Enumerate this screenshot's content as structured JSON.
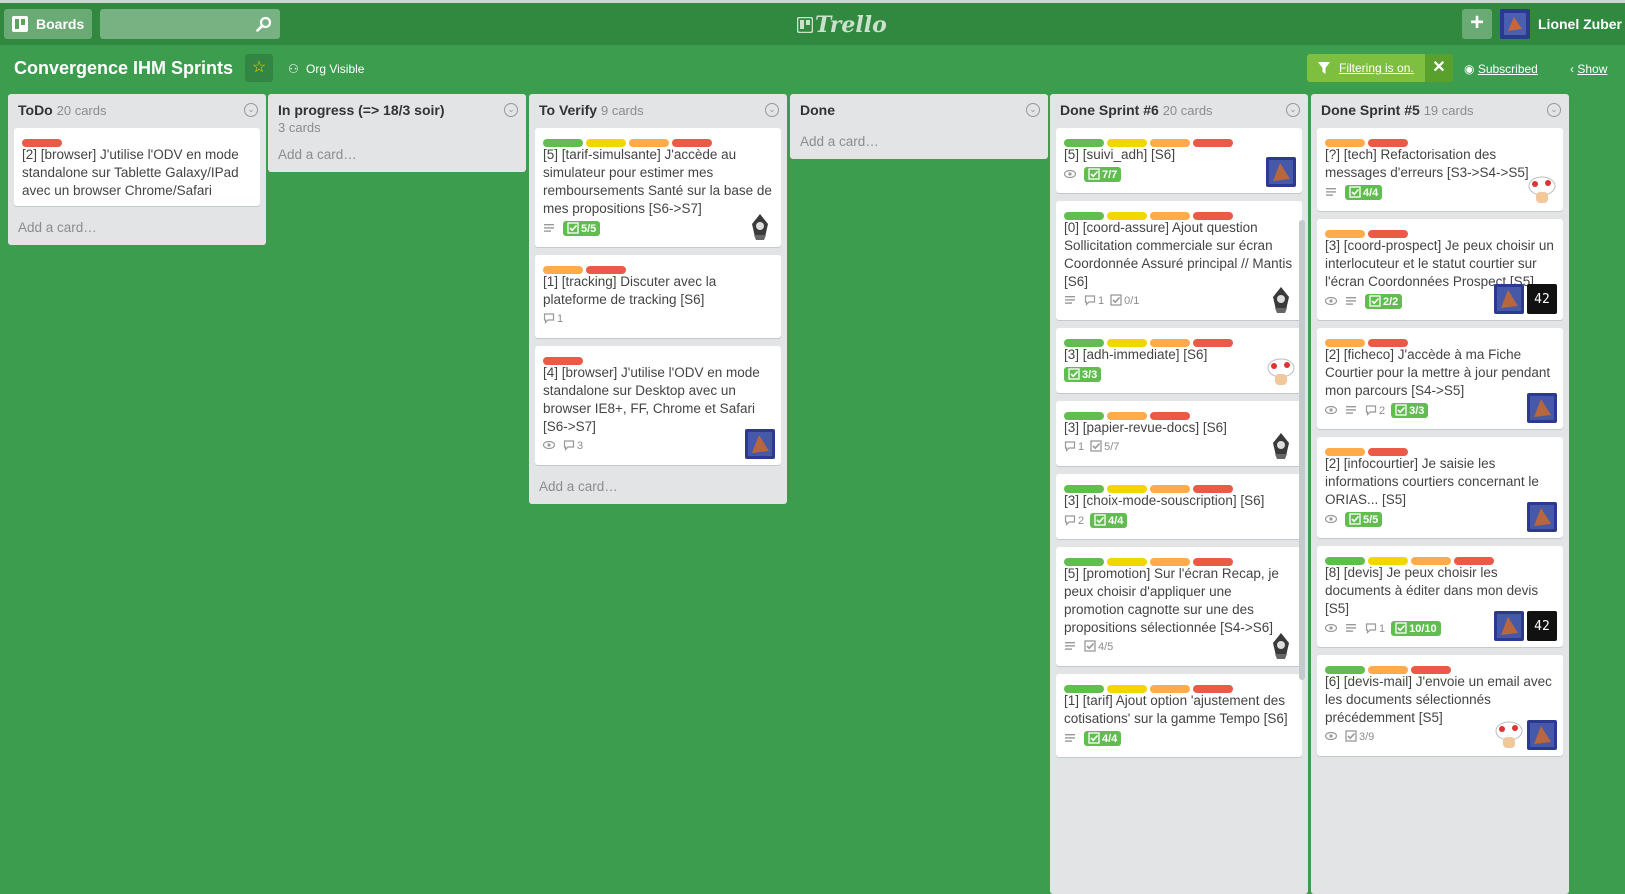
{
  "header": {
    "boards_label": "Boards",
    "search_placeholder": "",
    "logo": "Trello",
    "user_name": "Lionel Zuber"
  },
  "board": {
    "title": "Convergence IHM Sprints",
    "visibility": "Org Visible",
    "filter_label": "Filtering is on.",
    "subscribed_label": "Subscribed",
    "show_label": "Show"
  },
  "colors": {
    "green": "#61bd4f",
    "yellow": "#f2d600",
    "orange": "#ffab4a",
    "red": "#eb5a46"
  },
  "lists": [
    {
      "name": "ToDo",
      "count": "20 cards",
      "add_card": "Add a card…",
      "cards": [
        {
          "labels": [
            "red"
          ],
          "title": "[2] [browser] J'utilise l'ODV en mode standalone sur Tablette Galaxy/IPad avec un browser Chrome/Safari",
          "badges": [],
          "members": []
        }
      ]
    },
    {
      "name": "In progress (=> 18/3 soir)",
      "count": "3 cards",
      "add_card": "Add a card…",
      "cards": []
    },
    {
      "name": "To Verify",
      "count": "9 cards",
      "add_card": "Add a card…",
      "cards": [
        {
          "labels": [
            "green",
            "yellow",
            "orange",
            "red"
          ],
          "title": "[5] [tarif-simulsante] J'accède au simulateur pour estimer mes remboursements Santé sur la base de mes propositions [S6->S7]",
          "badges": [
            {
              "type": "desc"
            },
            {
              "type": "checklist",
              "text": "5/5",
              "done": true
            }
          ],
          "members": [
            "assassin"
          ]
        },
        {
          "labels": [
            "orange",
            "red"
          ],
          "title": "[1] [tracking] Discuter avec la plateforme de tracking [S6]",
          "badges": [
            {
              "type": "comments",
              "text": "1"
            }
          ],
          "members": []
        },
        {
          "labels": [
            "red"
          ],
          "title": "[4] [browser] J'utilise l'ODV en mode standalone sur Desktop avec un browser IE8+, FF, Chrome et Safari [S6->S7]",
          "badges": [
            {
              "type": "watch"
            },
            {
              "type": "comments",
              "text": "3"
            }
          ],
          "members": [
            "blue"
          ]
        }
      ]
    },
    {
      "name": "Done",
      "count": "",
      "add_card": "Add a card…",
      "cards": []
    },
    {
      "name": "Done Sprint #6",
      "count": "20 cards",
      "add_card": "",
      "cards": [
        {
          "labels": [
            "green",
            "yellow",
            "orange",
            "red"
          ],
          "title": "[5] [suivi_adh] [S6]",
          "badges": [
            {
              "type": "watch"
            },
            {
              "type": "checklist",
              "text": "7/7",
              "done": true
            }
          ],
          "members": [
            "blue"
          ]
        },
        {
          "labels": [
            "green",
            "yellow",
            "orange",
            "red"
          ],
          "title": "[0] [coord-assure] Ajout question Sollicitation commerciale sur écran Coordonnée Assuré principal // Mantis [S6]",
          "badges": [
            {
              "type": "desc"
            },
            {
              "type": "comments",
              "text": "1"
            },
            {
              "type": "checklist",
              "text": "0/1",
              "done": false
            }
          ],
          "members": [
            "assassin"
          ]
        },
        {
          "labels": [
            "green",
            "yellow",
            "orange",
            "red"
          ],
          "title": "[3] [adh-immediate] [S6]",
          "badges": [
            {
              "type": "checklist",
              "text": "3/3",
              "done": true
            }
          ],
          "members": [
            "toad"
          ]
        },
        {
          "labels": [
            "green",
            "orange",
            "red"
          ],
          "title": "[3] [papier-revue-docs] [S6]",
          "badges": [
            {
              "type": "comments",
              "text": "1"
            },
            {
              "type": "checklist",
              "text": "5/7",
              "done": false
            }
          ],
          "members": [
            "assassin"
          ]
        },
        {
          "labels": [
            "green",
            "yellow",
            "orange",
            "red"
          ],
          "title": "[3] [choix-mode-souscription] [S6]",
          "badges": [
            {
              "type": "comments",
              "text": "2"
            },
            {
              "type": "checklist",
              "text": "4/4",
              "done": true
            }
          ],
          "members": []
        },
        {
          "labels": [
            "green",
            "yellow",
            "orange",
            "red"
          ],
          "title": "[5] [promotion] Sur l'écran Recap, je peux choisir d'appliquer une promotion cagnotte sur une des propositions sélectionnée [S4->S6]",
          "badges": [
            {
              "type": "desc"
            },
            {
              "type": "checklist",
              "text": "4/5",
              "done": false
            }
          ],
          "members": [
            "assassin"
          ]
        },
        {
          "labels": [
            "green",
            "yellow",
            "orange",
            "red"
          ],
          "title": "[1] [tarif] Ajout option 'ajustement des cotisations' sur la gamme Tempo [S6]",
          "badges": [
            {
              "type": "desc"
            },
            {
              "type": "checklist",
              "text": "4/4",
              "done": true
            }
          ],
          "members": []
        }
      ]
    },
    {
      "name": "Done Sprint #5",
      "count": "19 cards",
      "add_card": "",
      "cards": [
        {
          "labels": [
            "orange",
            "red"
          ],
          "title": "[?] [tech] Refactorisation des messages d'erreurs [S3->S4->S5]",
          "badges": [
            {
              "type": "desc"
            },
            {
              "type": "checklist",
              "text": "4/4",
              "done": true
            }
          ],
          "members": [
            "toad"
          ]
        },
        {
          "labels": [
            "orange",
            "red"
          ],
          "title": "[3] [coord-prospect] Je peux choisir un interlocuteur et le statut courtier sur l'écran Coordonnées Prospect [S5]",
          "badges": [
            {
              "type": "watch"
            },
            {
              "type": "desc"
            },
            {
              "type": "checklist",
              "text": "2/2",
              "done": true
            }
          ],
          "members": [
            "blue",
            "42"
          ]
        },
        {
          "labels": [
            "orange",
            "red"
          ],
          "title": "[2] [ficheco] J'accède à ma Fiche Courtier pour la mettre à jour pendant mon parcours [S4->S5]",
          "badges": [
            {
              "type": "watch"
            },
            {
              "type": "desc"
            },
            {
              "type": "comments",
              "text": "2"
            },
            {
              "type": "checklist",
              "text": "3/3",
              "done": true
            }
          ],
          "members": [
            "blue"
          ]
        },
        {
          "labels": [
            "orange",
            "red"
          ],
          "title": "[2] [infocourtier] Je saisie les informations courtiers concernant le ORIAS... [S5]",
          "badges": [
            {
              "type": "watch"
            },
            {
              "type": "checklist",
              "text": "5/5",
              "done": true
            }
          ],
          "members": [
            "blue"
          ]
        },
        {
          "labels": [
            "green",
            "yellow",
            "orange",
            "red"
          ],
          "title": "[8] [devis] Je peux choisir les documents à éditer dans mon devis [S5]",
          "badges": [
            {
              "type": "watch"
            },
            {
              "type": "desc"
            },
            {
              "type": "comments",
              "text": "1"
            },
            {
              "type": "checklist",
              "text": "10/10",
              "done": true
            }
          ],
          "members": [
            "blue",
            "42"
          ]
        },
        {
          "labels": [
            "green",
            "orange",
            "red"
          ],
          "title": "[6] [devis-mail] J'envoie un email avec les documents sélectionnés précédemment [S5]",
          "badges": [
            {
              "type": "watch"
            },
            {
              "type": "checklist",
              "text": "3/9",
              "done": false
            }
          ],
          "members": [
            "toad",
            "blue"
          ]
        }
      ]
    }
  ]
}
